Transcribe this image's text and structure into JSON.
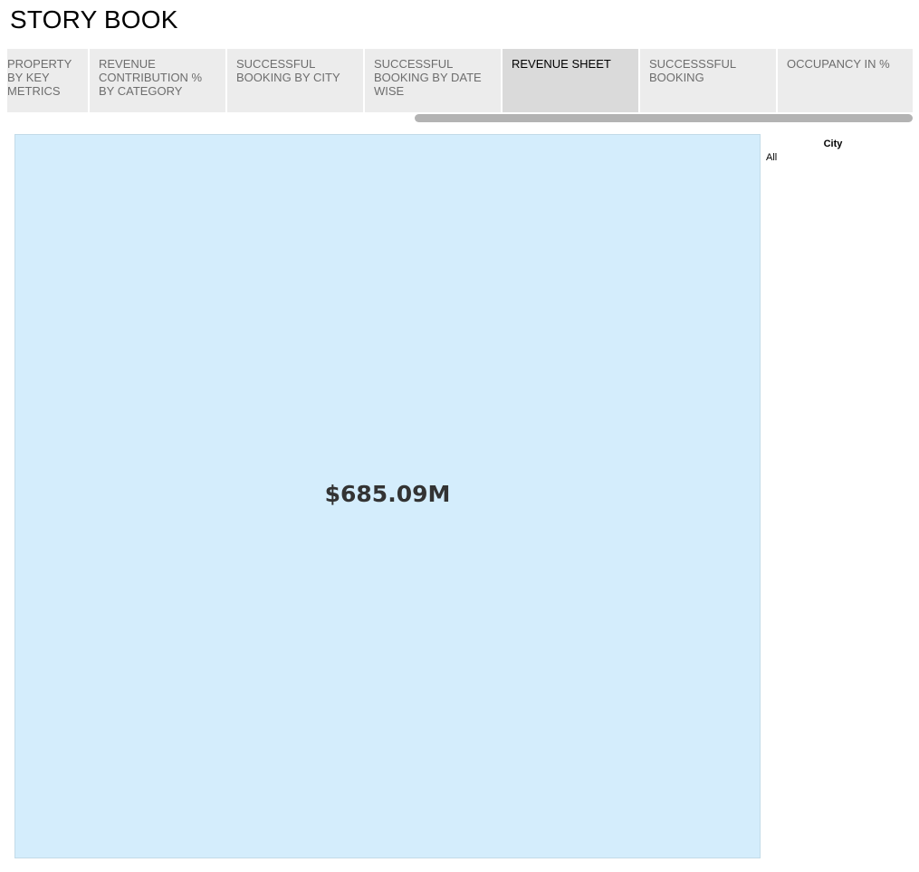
{
  "story": {
    "title": "STORY BOOK"
  },
  "tabs": [
    {
      "label": "PROPERTY BY KEY METRICS",
      "active": false
    },
    {
      "label": "REVENUE CONTRIBUTION % BY CATEGORY",
      "active": false
    },
    {
      "label": "SUCCESSFUL BOOKING BY CITY",
      "active": false
    },
    {
      "label": "SUCCESSFUL BOOKING BY DATE WISE",
      "active": false
    },
    {
      "label": "REVENUE SHEET",
      "active": true
    },
    {
      "label": "SUCCESSSFUL BOOKING",
      "active": false
    },
    {
      "label": "OCCUPANCY IN %",
      "active": false
    }
  ],
  "kpi": {
    "value": "$685.09M",
    "fill_color": "#d4edfc"
  },
  "filter": {
    "title": "City",
    "value": "All"
  },
  "colors": {
    "tab_bg": "#ececec",
    "tab_active_bg": "#dadada",
    "tab_text": "#6d6d6d",
    "scrollbar": "#b3b3b3"
  }
}
